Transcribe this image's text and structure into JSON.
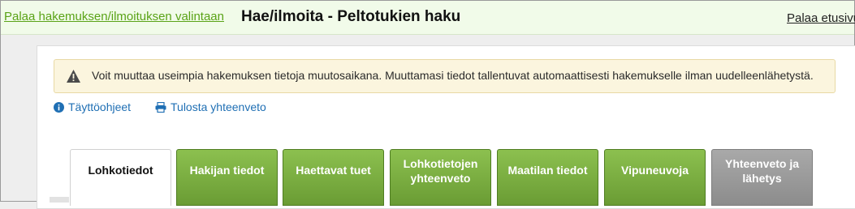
{
  "topbar": {
    "back_link": "Palaa hakemuksen/ilmoituksen valintaan",
    "title": "Hae/ilmoita - Peltotukien haku",
    "front_link": "Palaa etusivu"
  },
  "notice": {
    "icon": "warning-triangle-icon",
    "text": "Voit muuttaa useimpia hakemuksen tietoja muutosaikana. Muuttamasi tiedot tallentuvat automaattisesti hakemukselle ilman uudelleenlähetystä."
  },
  "links": {
    "instructions": "Täyttöohjeet",
    "print": "Tulosta yhteenveto"
  },
  "tabs": [
    {
      "label": "Lohkotiedot",
      "state": "active"
    },
    {
      "label": "Hakijan tiedot",
      "state": "normal"
    },
    {
      "label": "Haettavat tuet",
      "state": "normal"
    },
    {
      "label": "Lohkotietojen yhteenveto",
      "state": "normal"
    },
    {
      "label": "Maatilan tiedot",
      "state": "normal"
    },
    {
      "label": "Vipuneuvoja",
      "state": "normal"
    },
    {
      "label": "Yhteenveto ja lähetys",
      "state": "disabled"
    }
  ],
  "colors": {
    "tab_green": "#7bb043",
    "tab_gray": "#9b9b9b",
    "link_blue": "#1f6fb4",
    "back_link_green": "#5aa317",
    "notice_bg": "#fbf5de"
  }
}
